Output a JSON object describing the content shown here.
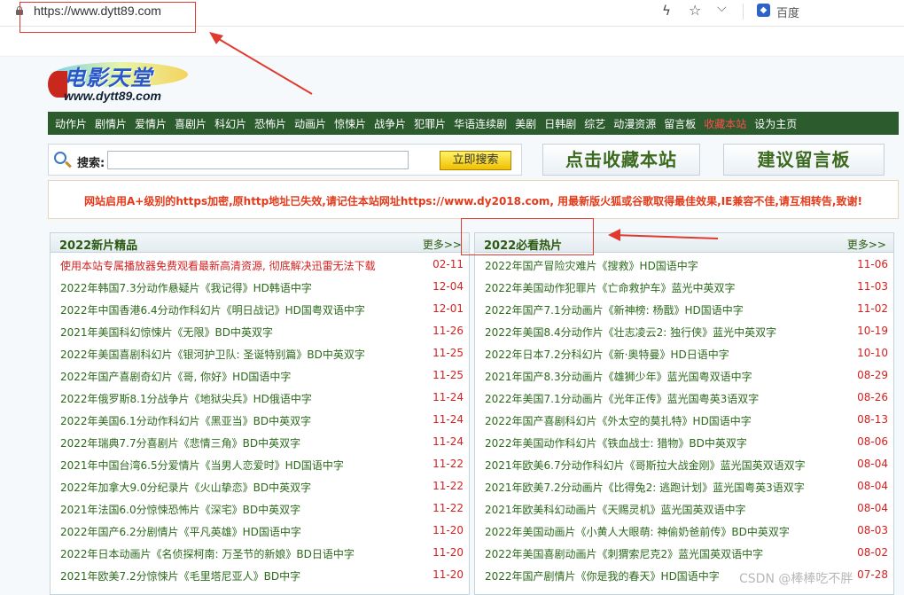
{
  "browser": {
    "url": "https://www.dytt89.com",
    "search_engine": "百度"
  },
  "logo": {
    "title": "电影天堂",
    "domain": "www.dytt89.com"
  },
  "nav": [
    "动作片",
    "剧情片",
    "爱情片",
    "喜剧片",
    "科幻片",
    "恐怖片",
    "动画片",
    "惊悚片",
    "战争片",
    "犯罪片",
    "华语连续剧",
    "美剧",
    "日韩剧",
    "综艺",
    "动漫资源",
    "留言板",
    "收藏本站",
    "设为主页"
  ],
  "search": {
    "label": "搜索:",
    "value": "",
    "button": "立即搜索"
  },
  "buttons": {
    "bookmark": "点击收藏本站",
    "guestbook": "建议留言板"
  },
  "notice": "网站启用A+级别的https加密,原http地址已失效,请记住本站网址https://www.dy2018.com, 用最新版火狐或谷歌取得最佳效果,IE兼容不佳,请互相转告,致谢!",
  "left_panel": {
    "title": "2022新片精品",
    "more": "更多>>",
    "items": [
      {
        "title": "使用本站专属播放器免费观看最新高清资源, 彻底解决迅雷无法下载",
        "date": "02-11",
        "highlight": true
      },
      {
        "title": "2022年韩国7.3分动作悬疑片《我记得》HD韩语中字",
        "date": "12-04"
      },
      {
        "title": "2022年中国香港6.4分动作科幻片《明日战记》HD国粤双语中字",
        "date": "12-01"
      },
      {
        "title": "2021年美国科幻惊悚片《无限》BD中英双字",
        "date": "11-26"
      },
      {
        "title": "2022年美国喜剧科幻片《银河护卫队: 圣诞特别篇》BD中英双字",
        "date": "11-25"
      },
      {
        "title": "2022年国产喜剧奇幻片《哥, 你好》HD国语中字",
        "date": "11-25"
      },
      {
        "title": "2022年俄罗斯8.1分战争片《地狱尖兵》HD俄语中字",
        "date": "11-24"
      },
      {
        "title": "2022年美国6.1分动作科幻片《黑亚当》BD中英双字",
        "date": "11-24"
      },
      {
        "title": "2022年瑞典7.7分喜剧片《悲情三角》BD中英双字",
        "date": "11-24"
      },
      {
        "title": "2021年中国台湾6.5分爱情片《当男人恋爱时》HD国语中字",
        "date": "11-22"
      },
      {
        "title": "2022年加拿大9.0分纪录片《火山挚恋》BD中英双字",
        "date": "11-22"
      },
      {
        "title": "2021年法国6.0分惊悚恐怖片《深宅》BD中英双字",
        "date": "11-22"
      },
      {
        "title": "2022年国产6.2分剧情片《平凡英雄》HD国语中字",
        "date": "11-20"
      },
      {
        "title": "2022年日本动画片《名侦探柯南: 万圣节的新娘》BD日语中字",
        "date": "11-20"
      },
      {
        "title": "2021年欧美7.2分惊悚片《毛里塔尼亚人》BD中字",
        "date": "11-20"
      }
    ]
  },
  "right_panel": {
    "title": "2022必看热片",
    "more": "更多>>",
    "items": [
      {
        "title": "2022年国产冒险灾难片《搜救》HD国语中字",
        "date": "11-06"
      },
      {
        "title": "2022年美国动作犯罪片《亡命救护车》蓝光中英双字",
        "date": "11-03"
      },
      {
        "title": "2022年国产7.1分动画片《新神榜: 杨戬》HD国语中字",
        "date": "11-02"
      },
      {
        "title": "2022年美国8.4分动作片《壮志凌云2: 独行侠》蓝光中英双字",
        "date": "10-19"
      },
      {
        "title": "2022年日本7.2分科幻片《新·奥特曼》HD日语中字",
        "date": "10-10"
      },
      {
        "title": "2021年国产8.3分动画片《雄狮少年》蓝光国粤双语中字",
        "date": "08-29"
      },
      {
        "title": "2022年美国7.1分动画片《光年正传》蓝光国粤英3语双字",
        "date": "08-26"
      },
      {
        "title": "2022年国产喜剧科幻片《外太空的莫扎特》HD国语中字",
        "date": "08-13"
      },
      {
        "title": "2022年美国动作科幻片《铁血战士: 猎物》BD中英双字",
        "date": "08-06"
      },
      {
        "title": "2021年欧美6.7分动作科幻片《哥斯拉大战金刚》蓝光国英双语双字",
        "date": "08-04"
      },
      {
        "title": "2021年欧美7.2分动画片《比得兔2: 逃跑计划》蓝光国粤英3语双字",
        "date": "08-04"
      },
      {
        "title": "2021年欧美科幻动画片《天赐灵机》蓝光国英双语中字",
        "date": "08-04"
      },
      {
        "title": "2022年美国动画片《小黄人大眼萌: 神偷奶爸前传》BD中英双字",
        "date": "08-03"
      },
      {
        "title": "2022年美国喜剧动画片《刺猬索尼克2》蓝光国英双语中字",
        "date": "08-02"
      },
      {
        "title": "2022年国产剧情片《你是我的春天》HD国语中字",
        "date": "07-28"
      }
    ]
  },
  "watermark": "CSDN @棒棒吃不胖"
}
